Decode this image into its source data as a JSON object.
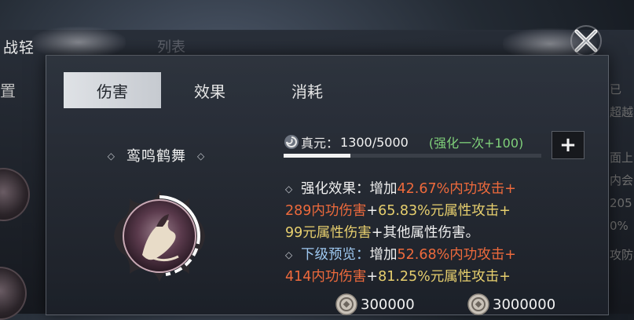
{
  "background": {
    "window_title": "战轻",
    "window_title_faint": "列表",
    "left_label": "置",
    "right_text": [
      "已",
      "超越",
      "面上",
      "内会",
      "205",
      "0%",
      "攻防与"
    ]
  },
  "tabs": [
    {
      "label": "伤害",
      "active": true
    },
    {
      "label": "效果",
      "active": false
    },
    {
      "label": "消耗",
      "active": false
    }
  ],
  "skill": {
    "name": "鸾鸣鹤舞",
    "diamond": "◇"
  },
  "yuan": {
    "label": "真元：",
    "value": "1300/5000",
    "bonus": "(强化一次+100)",
    "progress": 0.26,
    "plus_symbol": "+"
  },
  "effects": {
    "enhance_label": "强化效果：",
    "enhance_add": "增加",
    "enhance_v1": "42.67%内功攻击+",
    "enhance_v2": "289内功伤害",
    "enhance_plus1": "+",
    "enhance_v3": "65.83%元属性攻击+",
    "enhance_v4": "99元属性伤害",
    "enhance_tail": "+其他属性伤害。",
    "next_label": "下级预览：",
    "next_add": "增加",
    "next_v1": "52.68%内功攻击+",
    "next_v2": "414内功伤害",
    "next_plus1": "+",
    "next_v3": "81.25%元属性攻击+"
  },
  "costs": [
    {
      "icon": "coin-icon",
      "amount": "300000"
    },
    {
      "icon": "coin-icon",
      "amount": "3000000"
    }
  ],
  "colors": {
    "accent_red": "#ee6a3c",
    "accent_gold": "#e7cf6e",
    "accent_green": "#7fd07a",
    "accent_blue": "#9ec8f0",
    "tab_active_bg": "#dfe2e6"
  }
}
